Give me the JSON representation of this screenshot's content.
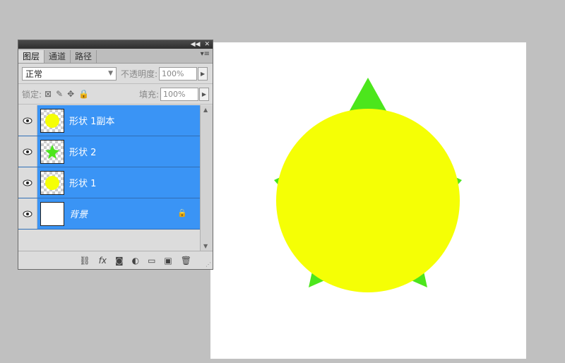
{
  "panel": {
    "tabs": [
      {
        "label": "图层"
      },
      {
        "label": "通道"
      },
      {
        "label": "路径"
      }
    ],
    "blend_mode": "正常",
    "opacity_label": "不透明度:",
    "opacity_value": "100%",
    "lock_label": "锁定:",
    "fill_label": "填充:",
    "fill_value": "100%"
  },
  "layers": [
    {
      "name": "形状 1副本",
      "thumb": "yellow-circle",
      "visible": true
    },
    {
      "name": "形状 2",
      "thumb": "green-star",
      "visible": true
    },
    {
      "name": "形状 1",
      "thumb": "yellow-circle",
      "visible": true
    },
    {
      "name": "背景",
      "thumb": "white",
      "visible": true,
      "locked": true
    }
  ],
  "bottom_icons": [
    "link-icon",
    "fx-icon",
    "mask-icon",
    "adjustment-icon",
    "folder-icon",
    "new-layer-icon",
    "trash-icon"
  ],
  "canvas": {
    "circle_color": "#f5ff05",
    "star_color": "#4ce61c",
    "background": "#ffffff"
  },
  "colors": {
    "selection": "#3a94f5",
    "workspace": "#c0c0c0"
  }
}
